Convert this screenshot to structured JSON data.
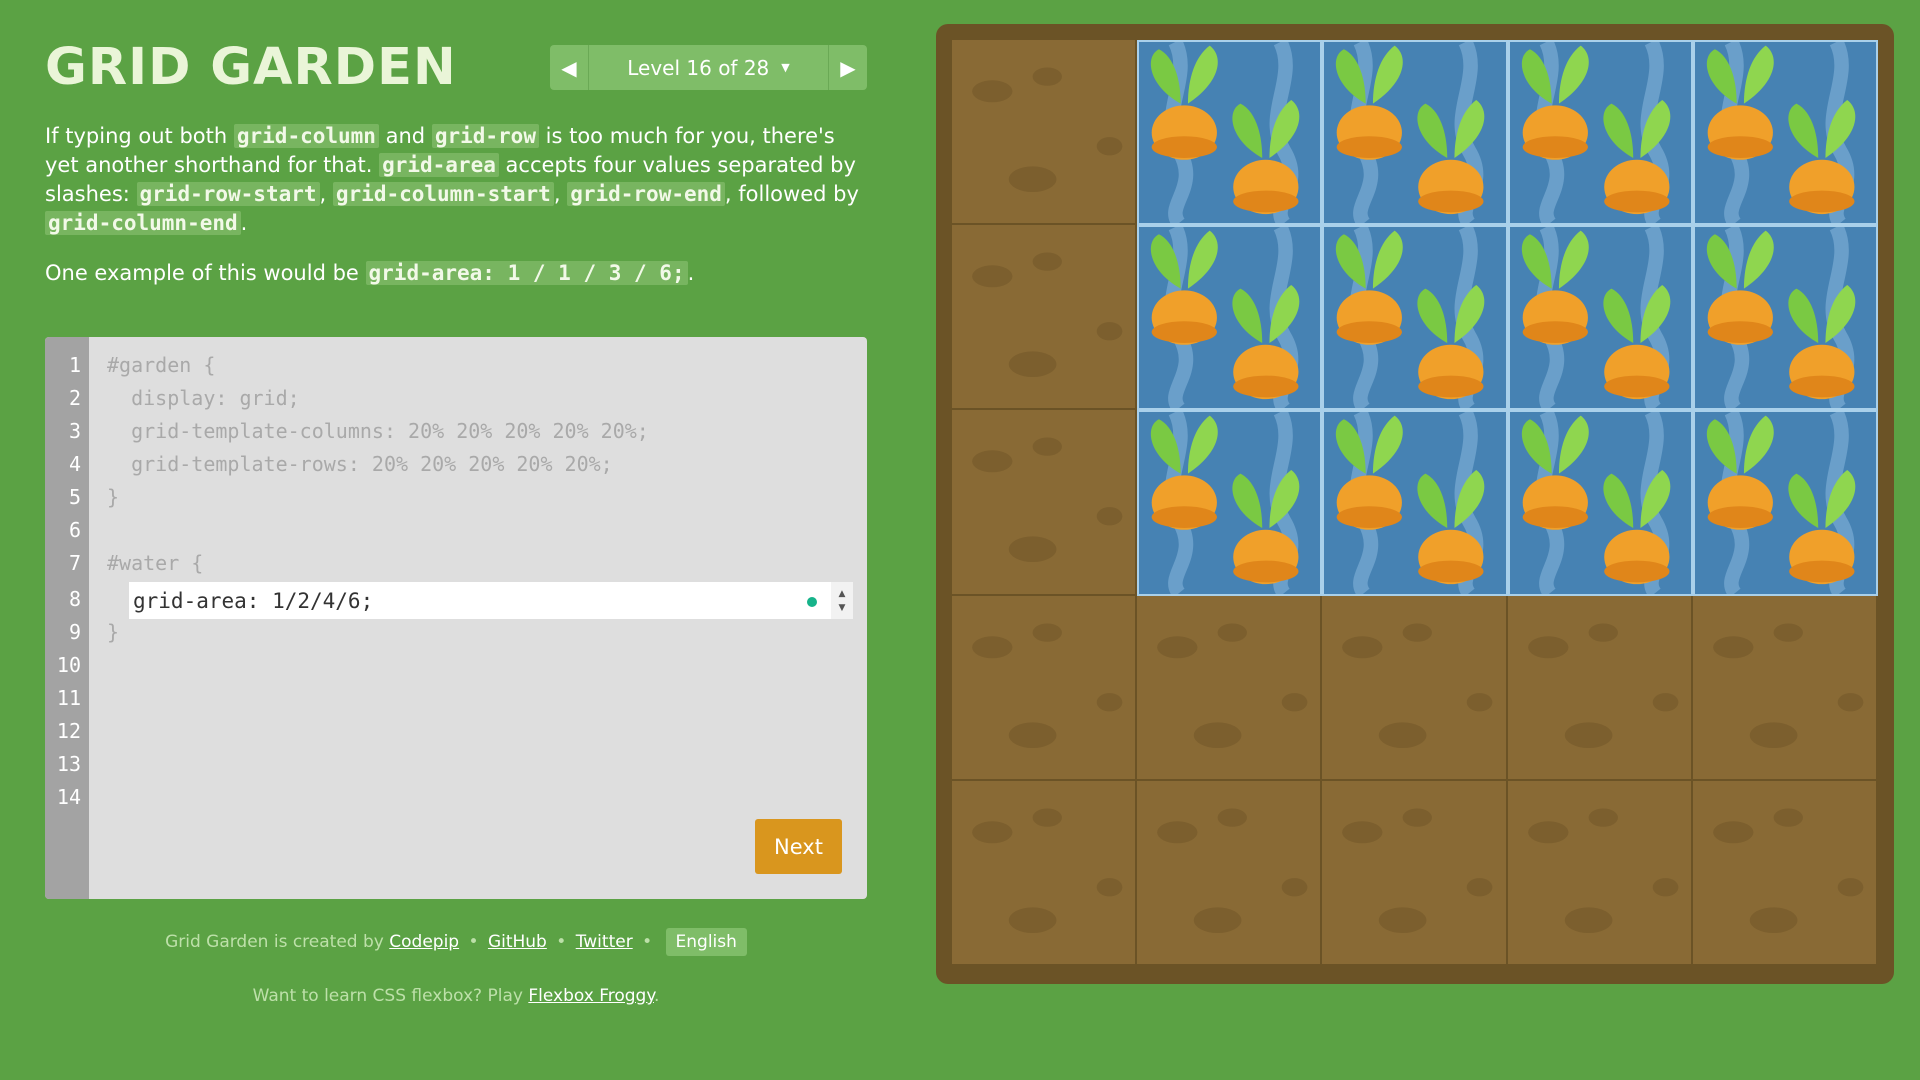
{
  "header": {
    "title": "GRID GARDEN",
    "level_label": "Level 16 of 28",
    "caret": "▼",
    "prev": "◀",
    "next": "▶"
  },
  "instructions": {
    "p1": {
      "t1": "If typing out both ",
      "c1": "grid-column",
      "t2": " and ",
      "c2": "grid-row",
      "t3": " is too much for you, there's yet another shorthand for that. ",
      "c3": "grid-area",
      "t4": " accepts four values separated by slashes: ",
      "c4": "grid-row-start",
      "t5": ", ",
      "c5": "grid-column-start",
      "t6": ", ",
      "c6": "grid-row-end",
      "t7": ", followed by ",
      "c7": "grid-column-end",
      "t8": "."
    },
    "p2": {
      "t1": "One example of this would be ",
      "c1": "grid-area: 1 / 1 / 3 / 6;",
      "t2": "."
    }
  },
  "editor": {
    "line_numbers": [
      "1",
      "2",
      "3",
      "4",
      "5",
      "6",
      "7",
      "8",
      "9",
      "10",
      "11",
      "12",
      "13",
      "14"
    ],
    "lines": {
      "l1": "#garden {",
      "l2": "  display: grid;",
      "l3": "  grid-template-columns: 20% 20% 20% 20% 20%;",
      "l4": "  grid-template-rows: 20% 20% 20% 20% 20%;",
      "l5": "}",
      "l7": "#water {",
      "l9": "}"
    },
    "input_value": "grid-area: 1/2/4/6;",
    "spinner_up": "▲",
    "spinner_down": "▼",
    "next_label": "Next"
  },
  "footer": {
    "credit_prefix": "Grid Garden is created by",
    "codepip": "Codepip",
    "github": "GitHub",
    "twitter": "Twitter",
    "separator": "•",
    "language": "English",
    "flexbox_prefix": "Want to learn CSS flexbox? Play",
    "flexbox_link": "Flexbox Froggy",
    "flexbox_suffix": "."
  },
  "garden": {
    "rows": 5,
    "cols": 5,
    "water_area": {
      "row_start": 1,
      "col_start": 2,
      "row_end": 4,
      "col_end": 6
    },
    "colors": {
      "background": "#5ba244",
      "soil": "#896a35",
      "soil_border": "#6b5326",
      "water": "#4682b3",
      "carrot": "#f0a02a",
      "leaf": "#7ac943"
    },
    "icons": [
      "carrot-sprout-icon",
      "water-wave-icon",
      "soil-pebble-icon"
    ]
  }
}
